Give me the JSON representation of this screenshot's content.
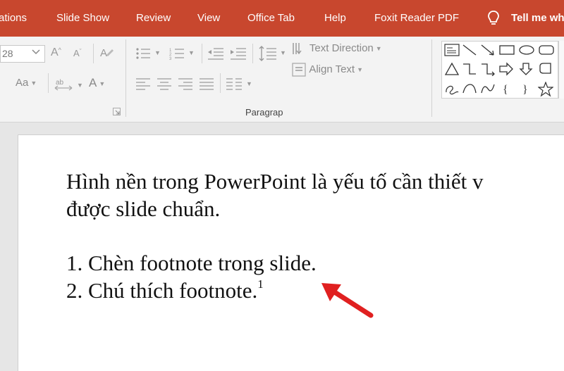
{
  "menu": {
    "tabs": [
      "ations",
      "Slide Show",
      "Review",
      "View",
      "Office Tab",
      "Help",
      "Foxit Reader PDF"
    ],
    "tell_me": "Tell me wh"
  },
  "ribbon": {
    "font_size_value": "28",
    "change_case_label": "Aa",
    "text_direction_label": "Text Direction",
    "align_text_label": "Align Text",
    "paragraph_group_label": "Paragrap",
    "shape_icons": [
      "text-box-icon",
      "line-icon",
      "arrow-line-icon",
      "rectangle-icon",
      "oval-icon",
      "rounded-rectangle-icon",
      "triangle-icon",
      "elbow-connector-icon",
      "curved-connector-icon",
      "right-arrow-icon",
      "down-arrow-icon",
      "flowchart-icon",
      "freeform-icon",
      "arc-icon",
      "curve-icon",
      "left-brace-icon",
      "right-brace-icon",
      "star-icon"
    ]
  },
  "slide": {
    "line1": "Hình nền trong PowerPoint là yếu tố cần thiết v",
    "line2": "được slide chuẩn.",
    "item1": "1. Chèn footnote trong slide.",
    "item2": "2. Chú thích footnote.",
    "footnote_marker": "1"
  },
  "colors": {
    "menubar": "#c8472e",
    "annotation_arrow": "#e02020"
  }
}
